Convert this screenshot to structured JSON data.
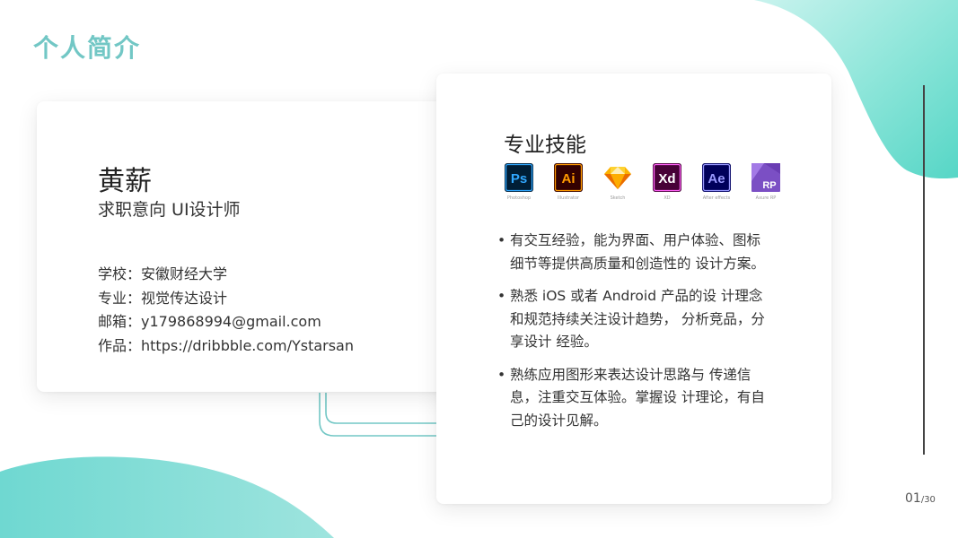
{
  "slide": {
    "title": "个人简介",
    "page_number": "01",
    "page_total": "/30"
  },
  "colors": {
    "accent": "#72c7c5",
    "blob_top": "#6fe0d2",
    "blob_bottom": "#7fd9d3",
    "connector": "#72c7c5"
  },
  "profile": {
    "name": "黄薪",
    "intent": "求职意向  UI设计师",
    "info": [
      {
        "label": "学校：",
        "value": "安徽财经大学"
      },
      {
        "label": "专业：",
        "value": "视觉传达设计"
      },
      {
        "label": "邮箱：",
        "value": "y179868994@gmail.com"
      },
      {
        "label": "作品：",
        "value": "https://dribbble.com/Ystarsan"
      }
    ]
  },
  "skills": {
    "title": "专业技能",
    "tools": [
      {
        "icon": "photoshop-icon",
        "abbr": "Ps",
        "caption": "Photoshop",
        "color": "#31a8ff",
        "bg": "#001e36"
      },
      {
        "icon": "illustrator-icon",
        "abbr": "Ai",
        "caption": "Illustrator",
        "color": "#ff9a00",
        "bg": "#330000"
      },
      {
        "icon": "sketch-icon",
        "abbr": "",
        "caption": "Sketch",
        "color": "#fdb300",
        "bg": ""
      },
      {
        "icon": "xd-icon",
        "abbr": "Xd",
        "caption": "XD",
        "color": "#ffffff",
        "bg": "#470137"
      },
      {
        "icon": "after-effects-icon",
        "abbr": "Ae",
        "caption": "After effects",
        "color": "#9999ff",
        "bg": "#00005b"
      },
      {
        "icon": "axure-rp-icon",
        "abbr": "RP",
        "caption": "Axure RP",
        "color": "#ffffff",
        "bg": "#7b4fc4"
      }
    ],
    "bullets": [
      "有交互经验，能为界面、用户体验、图标 细节等提供高质量和创造性的 设计方案。",
      "熟悉 iOS 或者 Android 产品的设 计理念和规范持续关注设计趋势， 分析竞品，分享设计 经验。",
      "熟练应用图形来表达设计思路与 传递信息，注重交互体验。掌握设 计理论，有自己的设计见解。"
    ]
  }
}
